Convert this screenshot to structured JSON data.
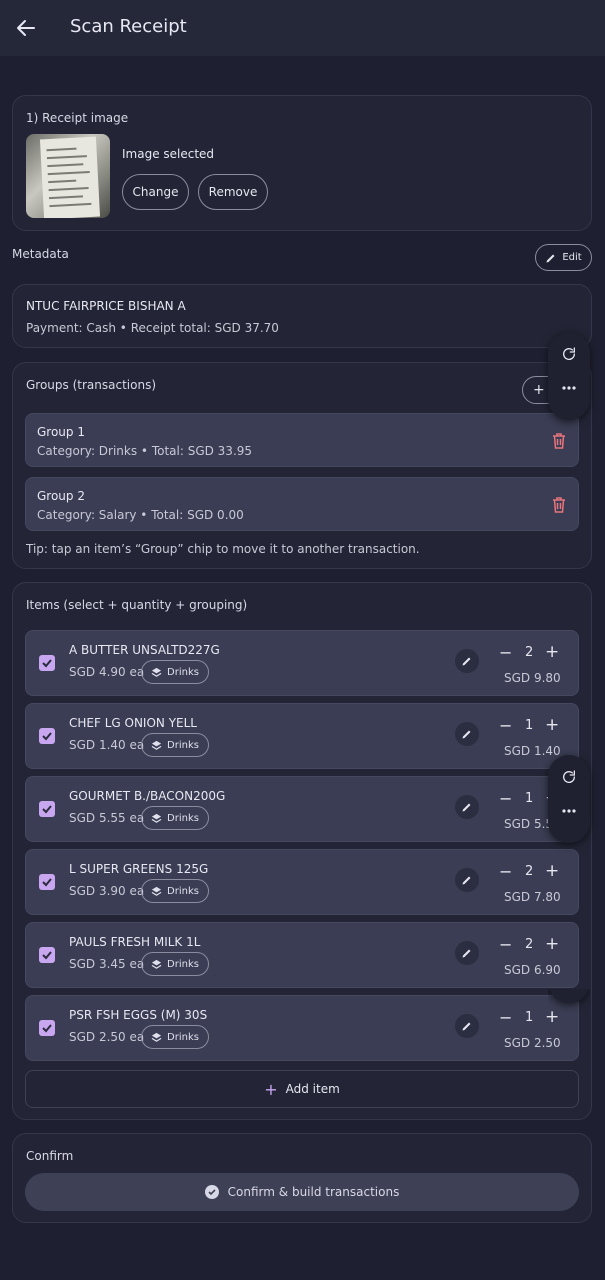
{
  "appbar": {
    "title": "Scan Receipt"
  },
  "receipt_image": {
    "section_label": "1) Receipt image",
    "status": "Image selected",
    "change_label": "Change",
    "remove_label": "Remove"
  },
  "metadata": {
    "section_label": "Metadata",
    "edit_label": "Edit",
    "store": "NTUC FAIRPRICE BISHAN A",
    "summary": "Payment: Cash • Receipt total: SGD 37.70"
  },
  "groups": {
    "section_label": "Groups (transactions)",
    "add_label": "+",
    "items": [
      {
        "name": "Group 1",
        "detail": "Category: Drinks • Total: SGD 33.95"
      },
      {
        "name": "Group 2",
        "detail": "Category: Salary • Total: SGD 0.00"
      }
    ],
    "tip": "Tip: tap an item’s “Group” chip to move it to another transaction."
  },
  "items": {
    "section_label": "Items (select + quantity + grouping)",
    "rows": [
      {
        "name": "A BUTTER UNSALTD227G",
        "unit_price": "SGD 4.90 ea",
        "group": "Drinks",
        "qty": "2",
        "total": "SGD 9.80",
        "checked": true
      },
      {
        "name": "CHEF LG ONION YELL",
        "unit_price": "SGD 1.40 ea",
        "group": "Drinks",
        "qty": "1",
        "total": "SGD 1.40",
        "checked": true
      },
      {
        "name": "GOURMET B./BACON200G",
        "unit_price": "SGD 5.55 ea",
        "group": "Drinks",
        "qty": "1",
        "total": "SGD 5.55",
        "checked": true
      },
      {
        "name": "L SUPER GREENS 125G",
        "unit_price": "SGD 3.90 ea",
        "group": "Drinks",
        "qty": "2",
        "total": "SGD 7.80",
        "checked": true
      },
      {
        "name": "PAULS FRESH MILK 1L",
        "unit_price": "SGD 3.45 ea",
        "group": "Drinks",
        "qty": "2",
        "total": "SGD 6.90",
        "checked": true
      },
      {
        "name": "PSR FSH EGGS (M) 30S",
        "unit_price": "SGD 2.50 ea",
        "group": "Drinks",
        "qty": "1",
        "total": "SGD 2.50",
        "checked": true
      }
    ],
    "add_item_label": "Add item",
    "minus_symbol": "−",
    "plus_symbol": "+"
  },
  "confirm": {
    "section_label": "Confirm",
    "button_label": "Confirm & build transactions"
  },
  "colors": {
    "background": "#1e2031",
    "card": "#232536",
    "row": "#3a3d53",
    "accent_checkbox": "#c9a6f0",
    "delete_icon": "#e8747c"
  }
}
